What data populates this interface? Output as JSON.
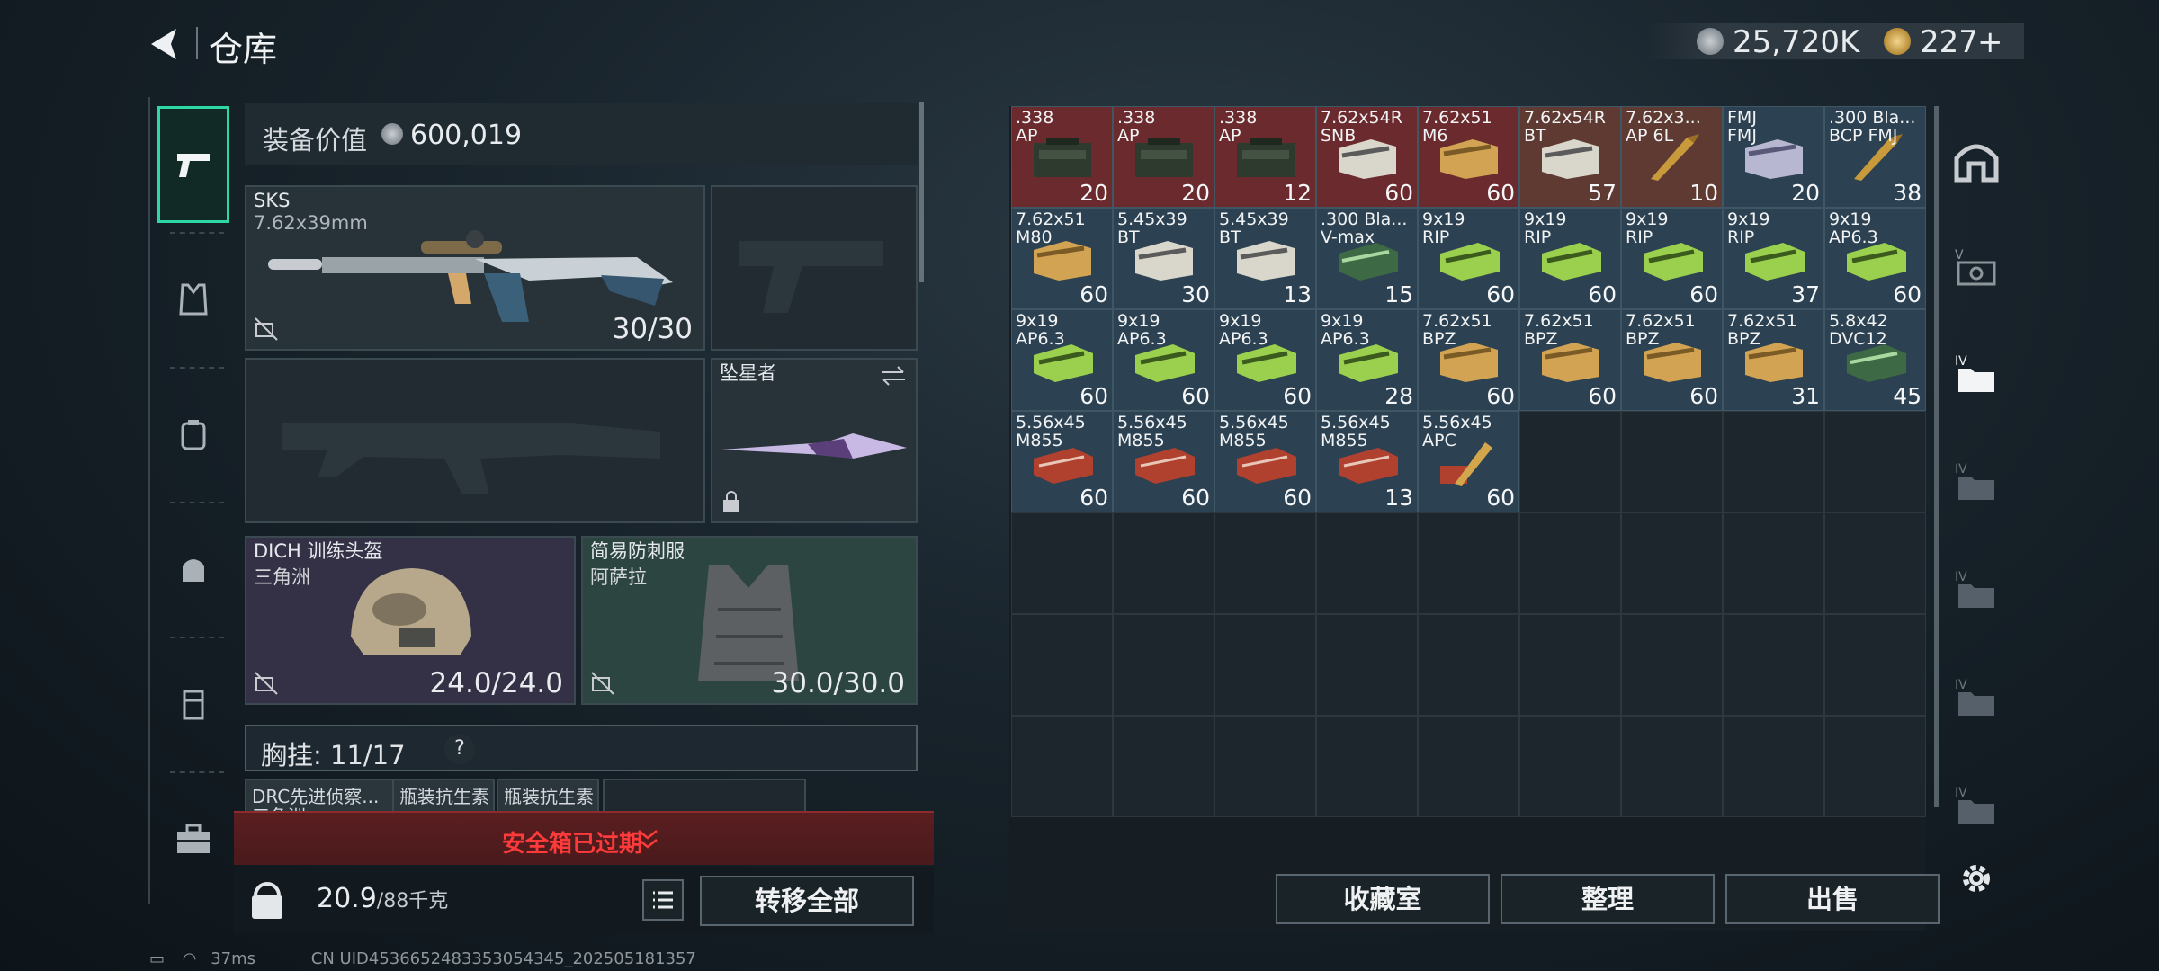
{
  "header": {
    "title": "仓库",
    "silver": "25,720K",
    "gold": "227",
    "plus": "+"
  },
  "equipment_value": {
    "label": "装备价值",
    "value": "600,019"
  },
  "primary_weapon": {
    "name": "SKS",
    "caliber": "7.62x39mm",
    "durability": "30/30"
  },
  "melee": {
    "name": "坠星者"
  },
  "helmet": {
    "name": "DICH 训练头盔",
    "origin": "三角洲",
    "durability": "24.0/24.0"
  },
  "armor": {
    "name": "简易防刺服",
    "origin": "阿萨拉",
    "durability": "30.0/30.0"
  },
  "chest_rig": {
    "label": "胸挂:",
    "capacity": "11/17",
    "help": "?"
  },
  "rig_items": [
    {
      "line1": "DRC先进侦察...",
      "line2": "三角洲"
    },
    {
      "line1": "瓶装抗生素",
      "line2": ""
    },
    {
      "line1": "瓶装抗生素",
      "line2": ""
    }
  ],
  "safe_box": {
    "status": "安全箱已过期"
  },
  "weight": {
    "current": "20.9",
    "max": "/88千克"
  },
  "buttons": {
    "transfer_all": "转移全部",
    "collection": "收藏室",
    "organize": "整理",
    "sell": "出售"
  },
  "stash_items": [
    {
      "l1": ".338",
      "l2": "AP",
      "count": "20",
      "color": "red",
      "box": "ammo-can"
    },
    {
      "l1": ".338",
      "l2": "AP",
      "count": "20",
      "color": "red",
      "box": "ammo-can"
    },
    {
      "l1": ".338",
      "l2": "AP",
      "count": "12",
      "color": "red",
      "box": "ammo-can"
    },
    {
      "l1": "7.62x54R",
      "l2": "SNB",
      "count": "60",
      "color": "red",
      "box": "white-box"
    },
    {
      "l1": "7.62x51",
      "l2": "M6",
      "count": "60",
      "color": "red",
      "box": "tan-box"
    },
    {
      "l1": "7.62x54R",
      "l2": "BT",
      "count": "57",
      "color": "brown",
      "box": "white-box"
    },
    {
      "l1": "7.62x3...",
      "l2": "AP 6L",
      "count": "10",
      "color": "brown",
      "box": "bullets"
    },
    {
      "l1": "FMJ",
      "l2": "FMJ",
      "count": "20",
      "color": "blue",
      "box": "lav-box"
    },
    {
      "l1": ".300 Bla...",
      "l2": "BCP FMJ",
      "count": "38",
      "color": "blue",
      "box": "bullets"
    },
    {
      "l1": "7.62x51",
      "l2": "M80",
      "count": "60",
      "color": "blue",
      "box": "tan-box"
    },
    {
      "l1": "5.45x39",
      "l2": "BT",
      "count": "30",
      "color": "blue",
      "box": "white-box"
    },
    {
      "l1": "5.45x39",
      "l2": "BT",
      "count": "13",
      "color": "blue",
      "box": "white-box"
    },
    {
      "l1": ".300 Bla...",
      "l2": "V-max",
      "count": "15",
      "color": "blue",
      "box": "green-box"
    },
    {
      "l1": "9x19",
      "l2": "RIP",
      "count": "60",
      "color": "blue",
      "box": "lime-box"
    },
    {
      "l1": "9x19",
      "l2": "RIP",
      "count": "60",
      "color": "blue",
      "box": "lime-box"
    },
    {
      "l1": "9x19",
      "l2": "RIP",
      "count": "60",
      "color": "blue",
      "box": "lime-box"
    },
    {
      "l1": "9x19",
      "l2": "RIP",
      "count": "37",
      "color": "blue",
      "box": "lime-box"
    },
    {
      "l1": "9x19",
      "l2": "AP6.3",
      "count": "60",
      "color": "blue",
      "box": "lime-box"
    },
    {
      "l1": "9x19",
      "l2": "AP6.3",
      "count": "60",
      "color": "blue",
      "box": "lime-box"
    },
    {
      "l1": "9x19",
      "l2": "AP6.3",
      "count": "60",
      "color": "blue",
      "box": "lime-box"
    },
    {
      "l1": "9x19",
      "l2": "AP6.3",
      "count": "60",
      "color": "blue",
      "box": "lime-box"
    },
    {
      "l1": "9x19",
      "l2": "AP6.3",
      "count": "28",
      "color": "blue",
      "box": "lime-box"
    },
    {
      "l1": "7.62x51",
      "l2": "BPZ",
      "count": "60",
      "color": "blue",
      "box": "tan-box"
    },
    {
      "l1": "7.62x51",
      "l2": "BPZ",
      "count": "60",
      "color": "blue",
      "box": "tan-box"
    },
    {
      "l1": "7.62x51",
      "l2": "BPZ",
      "count": "60",
      "color": "blue",
      "box": "tan-box"
    },
    {
      "l1": "7.62x51",
      "l2": "BPZ",
      "count": "31",
      "color": "blue",
      "box": "tan-box"
    },
    {
      "l1": "5.8x42",
      "l2": "DVC12",
      "count": "45",
      "color": "blue",
      "box": "green-box"
    },
    {
      "l1": "5.56x45",
      "l2": "M855",
      "count": "60",
      "color": "blue",
      "box": "red-box"
    },
    {
      "l1": "5.56x45",
      "l2": "M855",
      "count": "60",
      "color": "blue",
      "box": "red-box"
    },
    {
      "l1": "5.56x45",
      "l2": "M855",
      "count": "60",
      "color": "blue",
      "box": "red-box"
    },
    {
      "l1": "5.56x45",
      "l2": "M855",
      "count": "13",
      "color": "blue",
      "box": "red-box"
    },
    {
      "l1": "5.56x45",
      "l2": "APC",
      "count": "60",
      "color": "blue",
      "box": "bullets-red"
    }
  ],
  "status": {
    "latency": "37ms",
    "uid": "CN UID4536652483353054345_202505181357"
  }
}
